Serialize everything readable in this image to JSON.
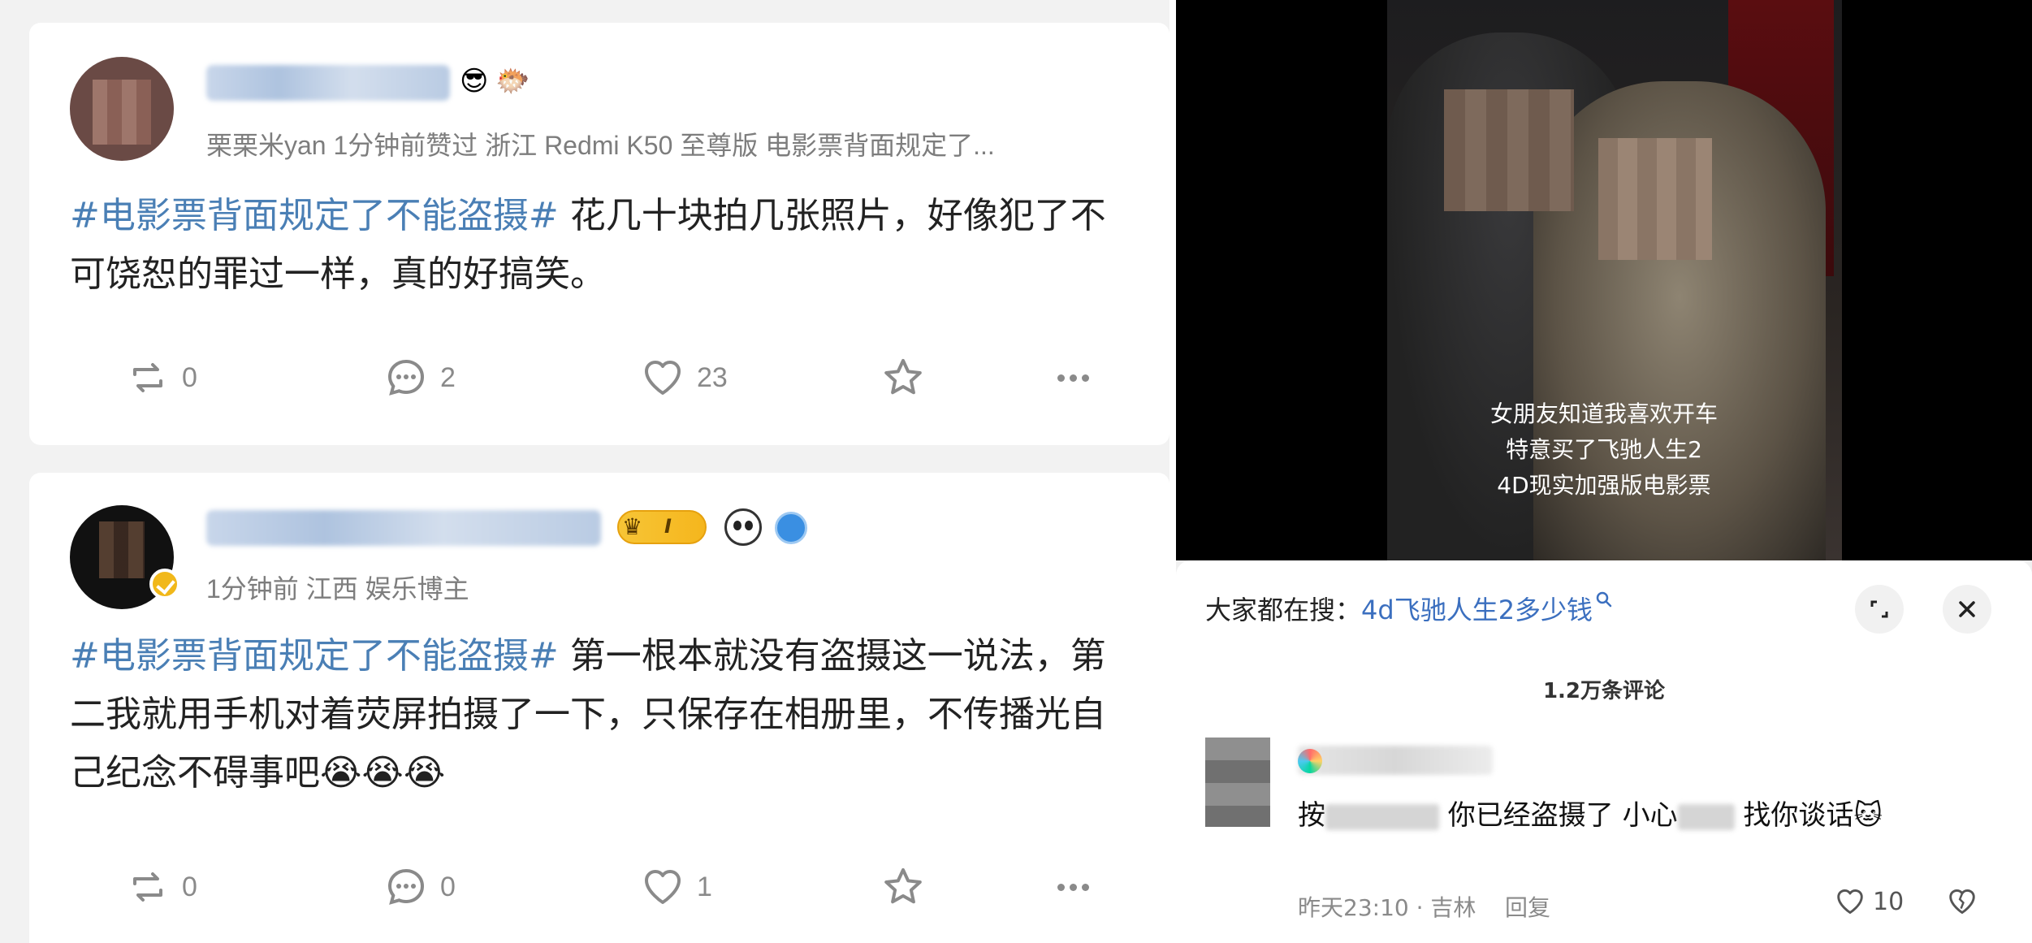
{
  "posts": [
    {
      "meta": "栗栗米yan 1分钟前赞过 浙江 Redmi K50 至尊版 电影票背面规定了...",
      "hashtag": "#电影票背面规定了不能盗摄#",
      "text": " 花几十块拍几张照片，好像犯了不可饶恕的罪过一样，真的好搞笑。",
      "reposts": "0",
      "comments": "2",
      "likes": "23",
      "name_emojis": [
        "😎",
        "🐡"
      ]
    },
    {
      "meta": "1分钟前 江西 娱乐博主",
      "hashtag": "#电影票背面规定了不能盗摄#",
      "text": " 第一根本就没有盗摄这一说法，第二我就用手机对着荧屏拍摄了一下，只保存在相册里，不传播光自己纪念不碍事吧😭😭😭",
      "reposts": "0",
      "comments": "0",
      "likes": "1",
      "vip_level": "I",
      "badges": [
        "crown-icon",
        "panda-icon",
        "blue-badge-icon"
      ]
    }
  ],
  "video": {
    "subtitles": [
      "女朋友知道我喜欢开车",
      "特意买了飞驰人生2",
      "4D现实加强版电影票"
    ]
  },
  "comment_sheet": {
    "search_label": "大家都在搜：",
    "search_query": "4d飞驰人生2多少钱",
    "count": "1.2万条评论",
    "comment": {
      "text_a": "按",
      "text_b": " 你已经盗摄了 小心",
      "text_c": " 找你谈话",
      "emoji": "🐱",
      "time": "昨天23:10 · 吉林",
      "reply": "回复",
      "likes": "10"
    }
  },
  "colors": {
    "hashtag": "#4a7fb5",
    "meta_gray": "#7d7d7d",
    "search_link": "#3b6fbf"
  }
}
